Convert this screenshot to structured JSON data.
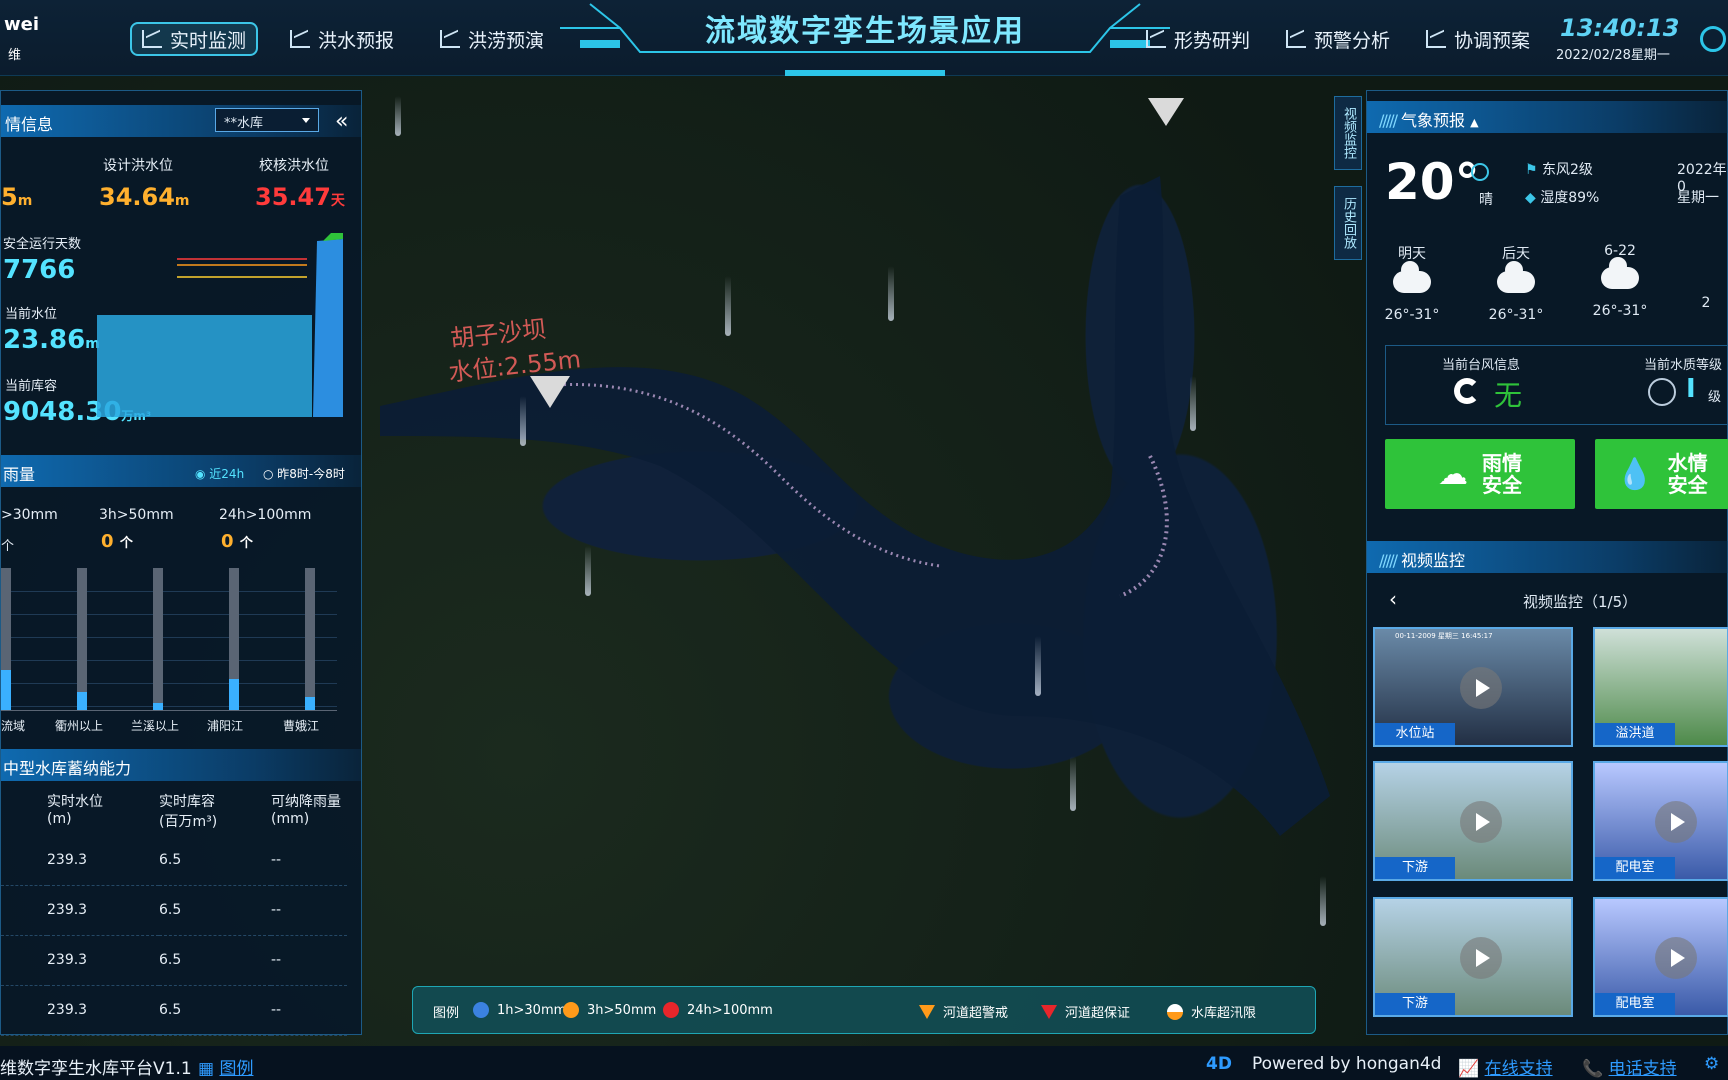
{
  "header": {
    "logo_text": "wei",
    "logo_sub": "维",
    "title": "流域数字孪生场景应用",
    "time": "13:40:13",
    "date": "2022/02/28星期一",
    "nav_left": [
      "实时监测",
      "洪水预报",
      "洪涝预演"
    ],
    "nav_right": [
      "形势研判",
      "预警分析",
      "协调预案"
    ]
  },
  "reservoir": {
    "header": "情信息",
    "select_value": "**水库",
    "design_label": "设计洪水位",
    "design_value": "34.64",
    "design_unit": "m",
    "check_label": "校核洪水位",
    "check_value": "35.47",
    "check_unit": "天",
    "partial_value": "5",
    "partial_unit": "m",
    "safe_days_label": "安全运行天数",
    "safe_days_value": "7766",
    "level_label": "当前水位",
    "level_value": "23.86",
    "level_unit": "m",
    "storage_label": "当前库容",
    "storage_value": "9048.30",
    "storage_unit": "万m³",
    "fill_level": 0.55
  },
  "rainfall": {
    "header": "雨量",
    "opt1": "近24h",
    "opt2": "昨8时-今8时",
    "c1_label": ">30mm",
    "c1_value": "个",
    "c2_label": "3h>50mm",
    "c2_value": "0",
    "c2_unit": "个",
    "c3_label": "24h>100mm",
    "c3_value": "0",
    "c3_unit": "个",
    "bars": [
      {
        "name": "流域",
        "level": 0.28
      },
      {
        "name": "衢州以上",
        "level": 0.13
      },
      {
        "name": "兰溪以上",
        "level": 0.05
      },
      {
        "name": "浦阳江",
        "level": 0.22
      },
      {
        "name": "曹娥江",
        "level": 0.09
      }
    ]
  },
  "capacity": {
    "header": "中型水库蓄纳能力",
    "col1": "实时水位",
    "col1b": "(m)",
    "col2": "实时库容",
    "col2b": "(百万m³)",
    "col3": "可纳降雨量",
    "col3b": "(mm)",
    "rows": [
      [
        "239.3",
        "6.5",
        "--"
      ],
      [
        "239.3",
        "6.5",
        "--"
      ],
      [
        "239.3",
        "6.5",
        "--"
      ],
      [
        "239.3",
        "6.5",
        "--"
      ]
    ]
  },
  "map": {
    "label1": "胡子沙坝",
    "label2": "水位:2.55m"
  },
  "side_tabs": [
    "视频监控",
    "历史回放"
  ],
  "weather": {
    "header": "气象预报",
    "temp": "20°",
    "cond": "晴",
    "wind": "东风2级",
    "humidity": "湿度89%",
    "date_part": "2022年0",
    "weekday": "星期一",
    "days": [
      {
        "name": "明天",
        "range": "26°-31°"
      },
      {
        "name": "后天",
        "range": "26°-31°"
      },
      {
        "name": "6-22",
        "range": "26°-31°"
      },
      {
        "name": "",
        "range": "2"
      }
    ],
    "typhoon_label": "当前台风信息",
    "typhoon_value": "无",
    "quality_label": "当前水质等级",
    "quality_value": "I",
    "quality_unit": "级",
    "btn1_a": "雨情",
    "btn1_b": "安全",
    "btn2_a": "水情",
    "btn2_b": "安全"
  },
  "video": {
    "header": "视频监控",
    "pager": "视频监控（1/5）",
    "stamp": "00-11-2009 星期三 16:45:17",
    "items": [
      "水位站",
      "溢洪道",
      "下游",
      "配电室",
      "下游",
      "配电室"
    ]
  },
  "legend": {
    "title": "图例",
    "items": [
      "1h>30mm",
      "3h>50mm",
      "24h>100mm",
      "河道超警戒",
      "河道超保证",
      "水库超汛限"
    ],
    "colors": [
      "#3b82e0",
      "#ff9a1a",
      "#e8262b",
      "#ff9a1a",
      "#e8262b",
      "#ff9a1a"
    ]
  },
  "footer": {
    "platform": "维数字孪生水库平台V1.1",
    "legend_link": "图例",
    "powered": "Powered by hongan4d",
    "online": "在线支持",
    "phone": "电话支持"
  }
}
